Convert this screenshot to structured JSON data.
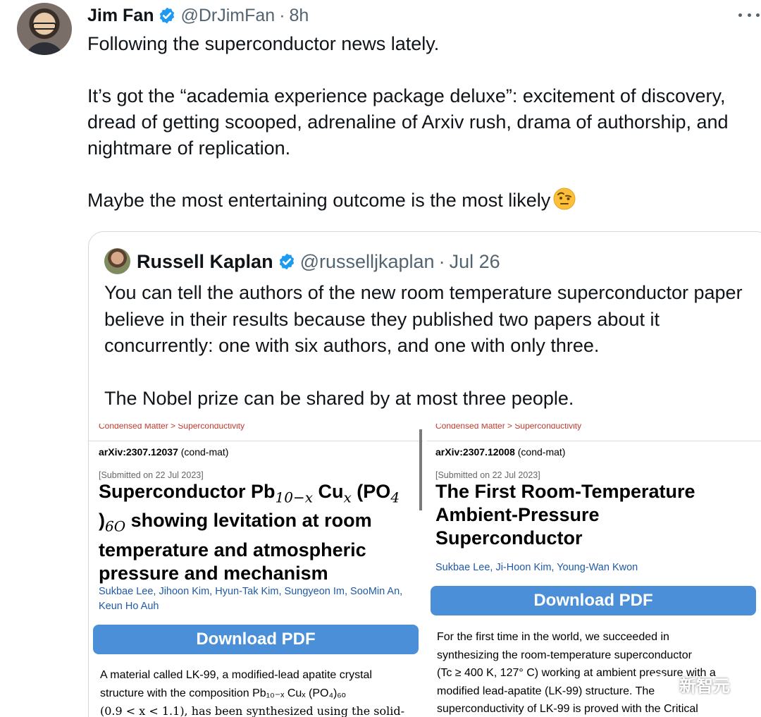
{
  "tweet": {
    "author_name": "Jim Fan",
    "handle": "@DrJimFan",
    "separator": "·",
    "time": "8h",
    "paragraphs": [
      "Following the superconductor news lately.",
      "It’s got the “academia experience package deluxe”: excitement of discovery, dread of getting scooped, adrenaline of Arxiv rush, drama of authorship, and nightmare of replication.",
      "Maybe the most entertaining outcome is the most likely"
    ],
    "emoji": "face-with-raised-eyebrow-emoji"
  },
  "quoted_tweet": {
    "author_name": "Russell Kaplan",
    "handle": "@russelljkaplan",
    "separator": "·",
    "time": "Jul 26",
    "paragraphs": [
      "You can tell the authors of the new room temperature superconductor paper believe in their results because they published two papers about it concurrently: one with six authors, and one with only three.",
      "The Nobel prize can be shared by at most three people."
    ]
  },
  "papers": [
    {
      "breadcrumb": "Condensed Matter > Superconductivity",
      "arxiv_id": "arXiv:2307.12037",
      "category": "(cond-mat)",
      "submitted": "[Submitted on 22 Jul 2023]",
      "title_parts": {
        "a": "Superconductor Pb",
        "sub1": "10−x",
        "b": " Cu",
        "sub2": "x",
        "c": " (PO",
        "sub3": "4",
        "d": ")",
        "sub4": "6O",
        "e": " showing levitation at room temperature and atmospheric pressure and mechanism"
      },
      "authors": "Sukbae Lee, Jihoon Kim, Hyun-Tak Kim, Sungyeon Im, SooMin An, Keun Ho Auh",
      "download_label": "Download PDF",
      "abstract_line1": "A material called LK-99, a modified-lead apatite crystal",
      "abstract_line2": "structure with the composition Pb₁₀₋ₓ Cuₓ (PO₄)₆ₒ",
      "abstract_line3": "(0.9 < x < 1.1), has been synthesized using the solid-"
    },
    {
      "breadcrumb": "Condensed Matter > Superconductivity",
      "arxiv_id": "arXiv:2307.12008",
      "category": "(cond-mat)",
      "submitted": "[Submitted on 22 Jul 2023]",
      "title": "The First Room-Temperature Ambient-Pressure Superconductor",
      "authors": "Sukbae Lee, Ji-Hoon Kim, Young-Wan Kwon",
      "download_label": "Download PDF",
      "abstract_line1": "For the first time in the world, we succeeded in",
      "abstract_line2": "synthesizing the room-temperature superconductor",
      "abstract_line3": "(Tc ≥ 400 K, 127° C) working at ambient pressure with a",
      "abstract_line4": "modified lead-apatite (LK-99) structure. The",
      "abstract_line5": "superconductivity of LK-99 is proved with the Critical"
    }
  ],
  "watermark": {
    "text": "新智元",
    "icon": "wechat-icon"
  },
  "colors": {
    "verified_blue": "#1d9bf0",
    "link_blue": "#1f5aa6",
    "pdf_button": "#4a8fd8",
    "muted_text": "#536471",
    "border": "#cfd9de"
  }
}
